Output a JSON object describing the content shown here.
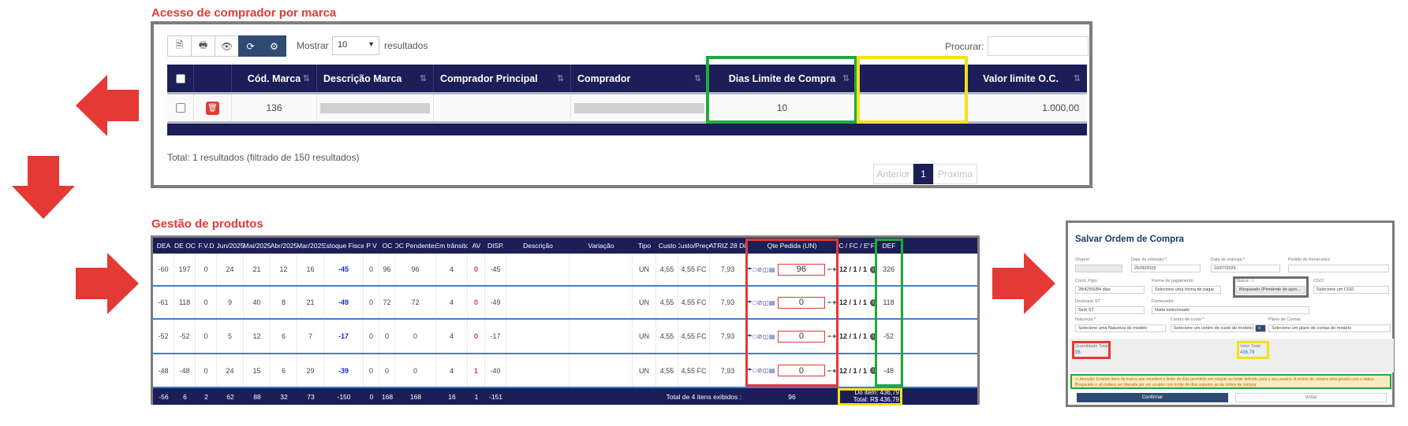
{
  "top_section": {
    "title": "Acesso de comprador por marca",
    "toolbar": {
      "icons": [
        "file-excel-icon",
        "print-icon",
        "eye-icon",
        "refresh-icon",
        "cogs-icon"
      ],
      "show_label": "Mostrar",
      "page_size": "10",
      "results_label": "resultados",
      "search_label": "Procurar:",
      "search_value": ""
    },
    "columns": [
      "Cód. Marca",
      "Descrição Marca",
      "Comprador Principal",
      "Comprador",
      "Dias Limite de Compra",
      "Valor limite O.C."
    ],
    "row": {
      "cod_marca": "136",
      "dias_limite": "10",
      "valor_limite": "1.000,00"
    },
    "total_info": "Total: 1 resultados (filtrado de 150 resultados)",
    "pagination": {
      "prev": "Anterior",
      "current": "1",
      "next": "Próxima"
    }
  },
  "bottom_section": {
    "title": "Gestão de produtos",
    "columns": [
      "DEA",
      "DE OC",
      "F.V.D",
      "Jun/2025",
      "Mai/2025",
      "Abr/2025",
      "Mar/2025",
      "Estoque Fiscal",
      "P V",
      "OC",
      "OC Pendentes",
      "Em trânsito",
      "AV",
      "DISP.",
      "Descrição",
      "Variação",
      "Tipo",
      "Custo",
      "Custo/Preço",
      "MATRIZ 28 Dias",
      "Qte Pedida (UN)",
      "EC / FC / EV",
      "F.",
      "DEF"
    ],
    "rows": [
      {
        "dea": "-60",
        "deoc": "197",
        "fvd": "0",
        "jun": "24",
        "mai": "21",
        "abr": "12",
        "mar": "16",
        "estoque": "-45",
        "pv": "0",
        "oc": "96",
        "ocp": "96",
        "transito": "4",
        "av": "0",
        "disp": "-45",
        "tipo": "UN",
        "custo": "4,55",
        "custo_preco": "4,55 FC",
        "matriz": "7,93",
        "qte": "96",
        "ec": "12 / 1 / 1",
        "def": "326"
      },
      {
        "dea": "-61",
        "deoc": "118",
        "fvd": "0",
        "jun": "9",
        "mai": "40",
        "abr": "8",
        "mar": "21",
        "estoque": "-49",
        "pv": "0",
        "oc": "72",
        "ocp": "72",
        "transito": "4",
        "av": "0",
        "disp": "-49",
        "tipo": "UN",
        "custo": "4,55",
        "custo_preco": "4,55 FC",
        "matriz": "7,93",
        "qte": "0",
        "ec": "12 / 1 / 1",
        "def": "118"
      },
      {
        "dea": "-52",
        "deoc": "-52",
        "fvd": "0",
        "jun": "5",
        "mai": "12",
        "abr": "6",
        "mar": "7",
        "estoque": "-17",
        "pv": "0",
        "oc": "0",
        "ocp": "0",
        "transito": "4",
        "av": "0",
        "disp": "-17",
        "tipo": "UN",
        "custo": "4,55",
        "custo_preco": "4,55 FC",
        "matriz": "7,93",
        "qte": "0",
        "ec": "12 / 1 / 1",
        "def": "-52"
      },
      {
        "dea": "-48",
        "deoc": "-48",
        "fvd": "0",
        "jun": "24",
        "mai": "15",
        "abr": "6",
        "mar": "29",
        "estoque": "-39",
        "pv": "0",
        "oc": "0",
        "ocp": "0",
        "transito": "4",
        "av": "1",
        "disp": "-40",
        "tipo": "UN",
        "custo": "4,55",
        "custo_preco": "4,55 FC",
        "matriz": "7,93",
        "qte": "0",
        "ec": "12 / 1 / 1",
        "def": "-48"
      }
    ],
    "footer": {
      "dea": "-56",
      "deoc": "6",
      "fvd": "2",
      "jun": "62",
      "mai": "88",
      "abr": "32",
      "mar": "73",
      "estoque": "-150",
      "pv": "0",
      "oc": "168",
      "ocp": "168",
      "transito": "16",
      "av": "1",
      "disp": "-151",
      "total_items": "Total de 4 itens exibidos :",
      "qte_total": "96",
      "do_item": "Do item: 436,79",
      "total": "Total: R$ 436,79"
    }
  },
  "order_panel": {
    "title": "Salvar Ordem de Compra",
    "labels": {
      "origem": "Origem:",
      "emissao": "Data de emissão:",
      "entrega": "Data de entrega:",
      "pedido_fornecedor": "Pedido do fornecedor:",
      "cond_pgto": "Cond. Pgto:",
      "forma_pagamento": "Forma de pagamento:",
      "status": "Status:",
      "cgo": "CGO:",
      "desloque": "Desloque ST",
      "fornecedor": "Fornecedor:",
      "natureza": "Natureza:",
      "centro_custo": "Centro de custo:",
      "plano_contas": "Plano de Contas:",
      "qtd_total": "Quantidade Total:",
      "valor_total": "Valor Total:"
    },
    "values": {
      "emissao": "26/06/2025",
      "entrega": "10/07/2025",
      "cond_pgto": "28/42/56/84 dias",
      "forma_pagamento": "Selecione uma forma de pagar",
      "status": "Bloqueado (Pendente de apro...",
      "cgo": "Selecione um CGO",
      "desloque": "Sem ST",
      "fornecedor": "Nada selecionado",
      "natureza": "Selecione uma Natureza do modelo",
      "centro_custo": "Selecione um centro de custo do modelo",
      "plano_contas": "Selecione um plano de contas do modelo",
      "qtd_total": "96",
      "valor_total": "436,79"
    },
    "alert": "Atenção: Existem itens da marca que excedem o limite de dias permitido em relação ao limite definido para o seu usuário. A ordem de compra será gerada com o status Bloqueado e só poderá ser liberada por um usuário com limite de dias superior ao da ordem de compra.",
    "confirm": "Confirmar",
    "back": "Voltar"
  },
  "colors": {
    "accent_red": "#e53935",
    "header_navy": "#1b1e57",
    "highlight_green": "#1faa3c",
    "highlight_yellow": "#f4e11a"
  }
}
